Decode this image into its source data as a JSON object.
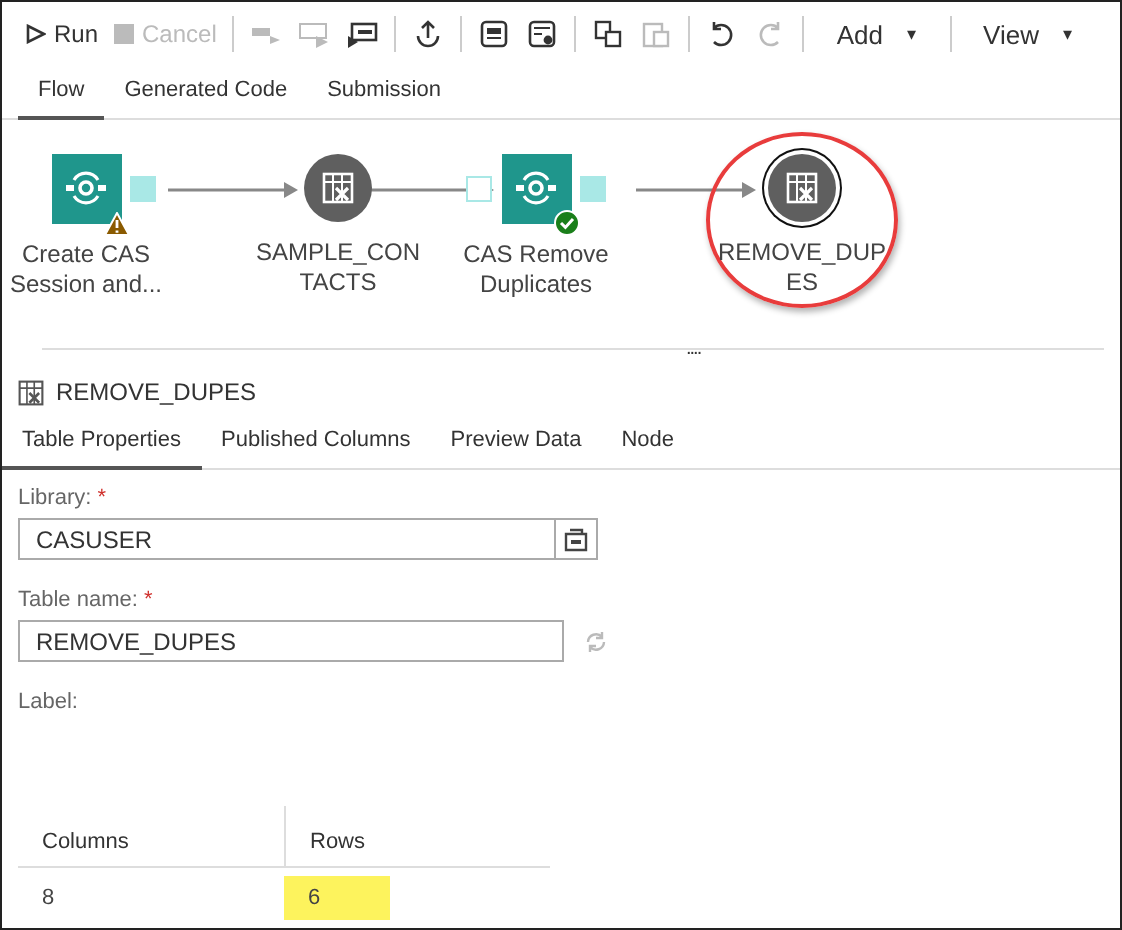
{
  "toolbar": [
    {
      "kind": "text",
      "label": "Run",
      "disabled": false
    },
    {
      "kind": "text",
      "label": "Cancel",
      "disabled": true
    },
    {
      "kind": "icon",
      "disabled": true
    },
    {
      "kind": "icon",
      "disabled": true
    },
    {
      "kind": "icon",
      "disabled": false
    },
    {
      "kind": "icon",
      "disabled": false
    },
    {
      "kind": "icon",
      "disabled": false
    },
    {
      "kind": "icon",
      "disabled": false
    },
    {
      "kind": "icon",
      "disabled": false
    },
    {
      "kind": "icon",
      "disabled": true
    },
    {
      "kind": "icon",
      "disabled": false
    },
    {
      "kind": "icon",
      "disabled": true
    },
    {
      "kind": "menu",
      "label": "Add",
      "caret": "▾"
    },
    {
      "kind": "menu",
      "label": "View",
      "caret": "▾"
    }
  ],
  "tabs": [
    {
      "label": "Flow",
      "selected": true
    },
    {
      "label": "Generated Code",
      "selected": false
    },
    {
      "label": "Submission",
      "selected": false
    }
  ],
  "flow": {
    "nodes": [
      {
        "kind": "step",
        "label": "Create CAS Session and...",
        "warning": true,
        "succeeded": false
      },
      {
        "kind": "table",
        "label": "SAMPLE_CON TACTS",
        "selected": false
      },
      {
        "kind": "step",
        "label": "CAS Remove Duplicates",
        "warning": false,
        "succeeded": true
      },
      {
        "kind": "table",
        "label": "REMOVE_DUP ES",
        "selected": true
      }
    ],
    "splitter": "...."
  },
  "details": {
    "title": "REMOVE_DUPES",
    "tabs": [
      {
        "label": "Table Properties",
        "selected": true
      },
      {
        "label": "Published Columns",
        "selected": false
      },
      {
        "label": "Preview Data",
        "selected": false
      },
      {
        "label": "Node",
        "selected": false
      }
    ],
    "fields": [
      {
        "kind": "library",
        "label": "Library:",
        "required": true,
        "value": "CASUSER"
      },
      {
        "kind": "name",
        "label": "Table name:",
        "required": true,
        "value": "REMOVE_DUPES"
      },
      {
        "kind": "label",
        "label": "Label:",
        "required": false
      }
    ],
    "required_mark": "*",
    "stats": {
      "columns": [
        "Columns",
        "Rows"
      ],
      "values": [
        {
          "text": "8",
          "highlighted": false
        },
        {
          "text": "6",
          "highlighted": true
        }
      ]
    }
  }
}
